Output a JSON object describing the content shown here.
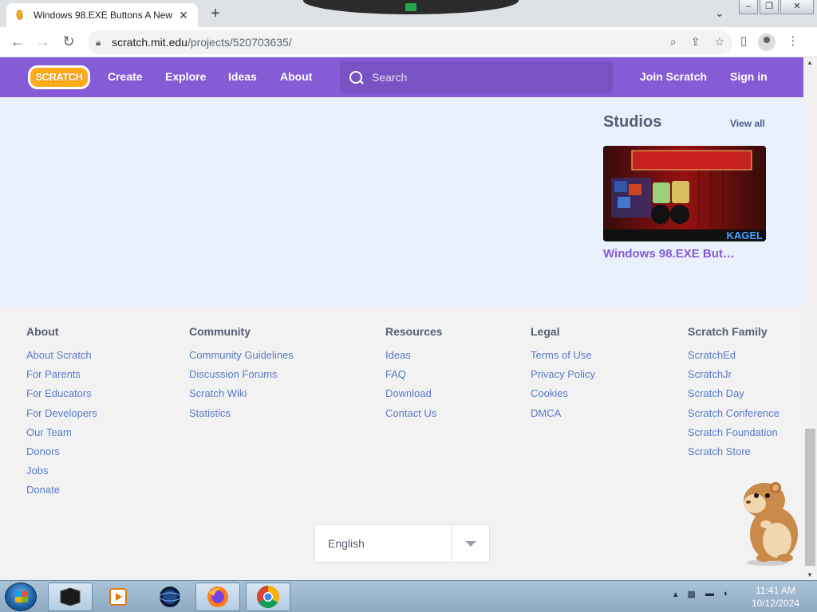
{
  "browser": {
    "tab_title": "Windows 98.EXE Buttons A New",
    "tab_close": "✕",
    "new_tab": "+",
    "url_host": "scratch.mit.edu",
    "url_path": "/projects/520703635/"
  },
  "scratch_nav": {
    "logo_text": "SCRATCH",
    "links": [
      "Create",
      "Explore",
      "Ideas",
      "About"
    ],
    "search_placeholder": "Search",
    "join": "Join Scratch",
    "signin": "Sign in"
  },
  "studios": {
    "heading": "Studios",
    "view_all": "View all",
    "card_title": "Windows 98.EXE But…",
    "thumb_caption": "KAGEL"
  },
  "footer": {
    "columns": [
      {
        "title": "About",
        "links": [
          "About Scratch",
          "For Parents",
          "For Educators",
          "For Developers",
          "Our Team",
          "Donors",
          "Jobs",
          "Donate"
        ]
      },
      {
        "title": "Community",
        "links": [
          "Community Guidelines",
          "Discussion Forums",
          "Scratch Wiki",
          "Statistics"
        ]
      },
      {
        "title": "Resources",
        "links": [
          "Ideas",
          "FAQ",
          "Download",
          "Contact Us"
        ]
      },
      {
        "title": "Legal",
        "links": [
          "Terms of Use",
          "Privacy Policy",
          "Cookies",
          "DMCA"
        ]
      },
      {
        "title": "Scratch Family",
        "links": [
          "ScratchEd",
          "ScratchJr",
          "Scratch Day",
          "Scratch Conference",
          "Scratch Foundation",
          "Scratch Store"
        ]
      }
    ],
    "language": "English"
  },
  "taskbar": {
    "time": "11:41 AM",
    "date": "10/12/2024"
  },
  "colors": {
    "scratch_purple": "#855cd6",
    "page_bg": "#e9f1fc",
    "footer_bg": "#f2f2f2",
    "link_blue": "#5a7ac7"
  }
}
